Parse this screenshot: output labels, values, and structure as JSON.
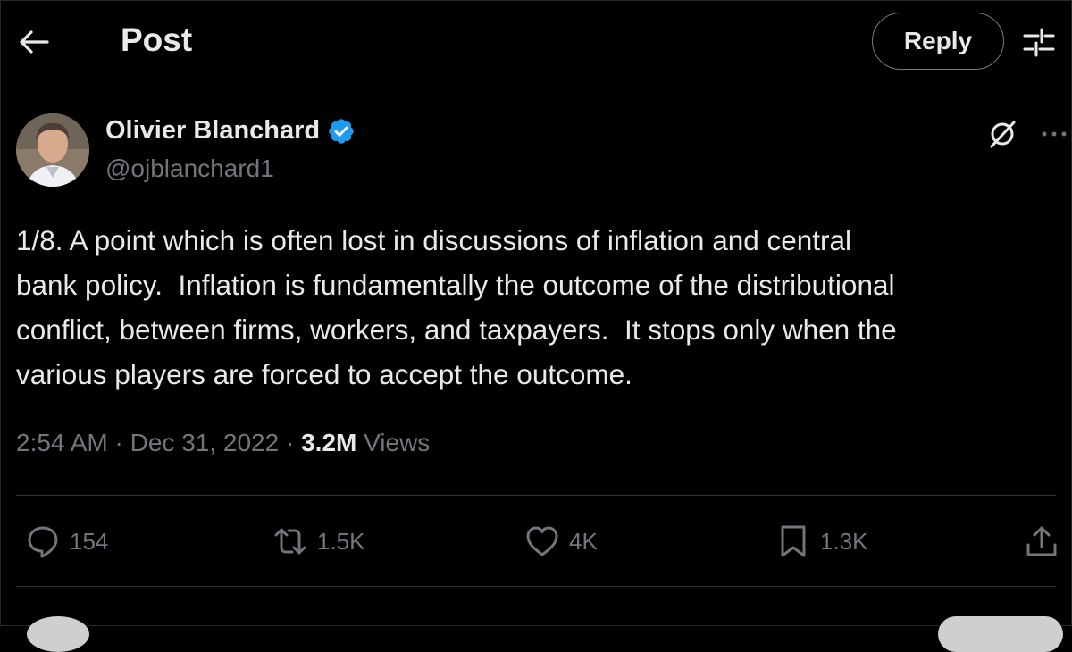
{
  "header": {
    "title": "Post",
    "reply_label": "Reply",
    "back_icon": "arrow-left-icon",
    "filter_icon": "sliders-icon"
  },
  "author": {
    "name": "Olivier Blanchard",
    "handle": "@ojblanchard1",
    "verified": true,
    "verified_color": "#1d9bf0"
  },
  "post": {
    "text": "1/8. A point which is often lost in discussions of inflation and central\nbank policy.  Inflation is fundamentally the outcome of the distributional\nconflict, between firms, workers, and taxpayers.  It stops only when the\nvarious players are forced to accept the outcome.",
    "time": "2:54 AM",
    "date": "Dec 31, 2022",
    "views_count": "3.2M",
    "views_label": "Views"
  },
  "actions": {
    "replies": "154",
    "reposts": "1.5K",
    "likes": "4K",
    "bookmarks": "1.3K"
  },
  "colors": {
    "background": "#000000",
    "text": "#e7e9ea",
    "muted": "#71767b",
    "accent": "#1d9bf0"
  }
}
